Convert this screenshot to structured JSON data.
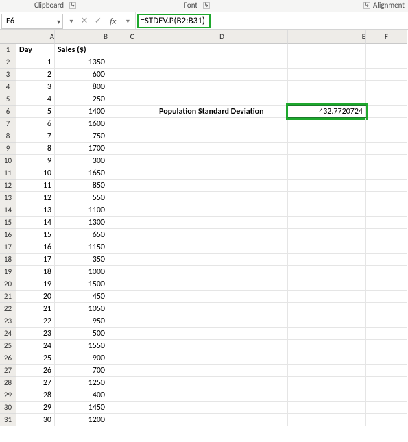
{
  "ribbon": {
    "group1": "Clipboard",
    "group2": "Font",
    "group3": "Alignment"
  },
  "namebox": {
    "value": "E6"
  },
  "formula": {
    "fx": "fx",
    "text": "=STDEV.P(B2:B31)"
  },
  "columns": [
    "A",
    "B",
    "C",
    "D",
    "E",
    "F"
  ],
  "headers": {
    "A": "Day",
    "B": "Sales ($)"
  },
  "label_D6": "Population Standard Deviation",
  "result_E6": "432.7720724",
  "rows": [
    {
      "n": "1",
      "day": "1",
      "sales": "1350"
    },
    {
      "n": "2",
      "day": "2",
      "sales": "600"
    },
    {
      "n": "3",
      "day": "3",
      "sales": "800"
    },
    {
      "n": "4",
      "day": "4",
      "sales": "250"
    },
    {
      "n": "5",
      "day": "5",
      "sales": "1400"
    },
    {
      "n": "6",
      "day": "6",
      "sales": "1600"
    },
    {
      "n": "7",
      "day": "7",
      "sales": "750"
    },
    {
      "n": "8",
      "day": "8",
      "sales": "1700"
    },
    {
      "n": "9",
      "day": "9",
      "sales": "300"
    },
    {
      "n": "10",
      "day": "10",
      "sales": "1650"
    },
    {
      "n": "11",
      "day": "11",
      "sales": "850"
    },
    {
      "n": "12",
      "day": "12",
      "sales": "550"
    },
    {
      "n": "13",
      "day": "13",
      "sales": "1100"
    },
    {
      "n": "14",
      "day": "14",
      "sales": "1300"
    },
    {
      "n": "15",
      "day": "15",
      "sales": "650"
    },
    {
      "n": "16",
      "day": "16",
      "sales": "1150"
    },
    {
      "n": "17",
      "day": "17",
      "sales": "350"
    },
    {
      "n": "18",
      "day": "18",
      "sales": "1000"
    },
    {
      "n": "19",
      "day": "19",
      "sales": "1500"
    },
    {
      "n": "20",
      "day": "20",
      "sales": "450"
    },
    {
      "n": "21",
      "day": "21",
      "sales": "1050"
    },
    {
      "n": "22",
      "day": "22",
      "sales": "950"
    },
    {
      "n": "23",
      "day": "23",
      "sales": "500"
    },
    {
      "n": "24",
      "day": "24",
      "sales": "1550"
    },
    {
      "n": "25",
      "day": "25",
      "sales": "900"
    },
    {
      "n": "26",
      "day": "26",
      "sales": "700"
    },
    {
      "n": "27",
      "day": "27",
      "sales": "1250"
    },
    {
      "n": "28",
      "day": "28",
      "sales": "400"
    },
    {
      "n": "29",
      "day": "29",
      "sales": "1450"
    },
    {
      "n": "30",
      "day": "30",
      "sales": "1200"
    }
  ],
  "rownums": [
    "1",
    "2",
    "3",
    "4",
    "5",
    "6",
    "7",
    "8",
    "9",
    "10",
    "11",
    "12",
    "13",
    "14",
    "15",
    "16",
    "17",
    "18",
    "19",
    "20",
    "21",
    "22",
    "23",
    "24",
    "25",
    "26",
    "27",
    "28",
    "29",
    "30",
    "31"
  ]
}
